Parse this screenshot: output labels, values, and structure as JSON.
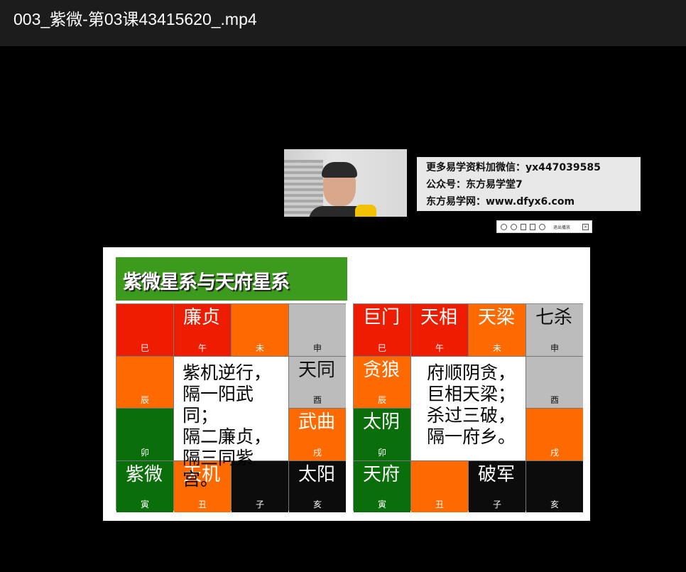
{
  "window": {
    "title": "003_紫微-第03课43415620_.mp4"
  },
  "promo": {
    "line1": "更多易学资料加微信：yx447039585",
    "line2": "公众号：东方易学堂7",
    "line3": "东方易学网：www.dfyx6.com"
  },
  "toolbar": {
    "label": "退出播放"
  },
  "slide": {
    "title": "紫微星系与天府星系",
    "left_chart": {
      "cells": [
        {
          "star": "",
          "branch": "巳",
          "color": "red"
        },
        {
          "star": "廉贞",
          "branch": "午",
          "color": "red"
        },
        {
          "star": "",
          "branch": "未",
          "color": "orange"
        },
        {
          "star": "",
          "branch": "申",
          "color": "gray"
        },
        {
          "star": "",
          "branch": "辰",
          "color": "orange"
        },
        {
          "star": "天同",
          "branch": "酉",
          "color": "gray"
        },
        {
          "star": "",
          "branch": "卯",
          "color": "green"
        },
        {
          "star": "武曲",
          "branch": "戌",
          "color": "orange"
        },
        {
          "star": "紫微",
          "branch": "寅",
          "color": "green"
        },
        {
          "star": "天机",
          "branch": "丑",
          "color": "orange"
        },
        {
          "star": "",
          "branch": "子",
          "color": "black"
        },
        {
          "star": "太阳",
          "branch": "亥",
          "color": "black"
        }
      ],
      "center_lines": [
        "紫机逆行，",
        "隔一阳武同；",
        "隔二廉贞，",
        "隔三同紫宫。"
      ]
    },
    "right_chart": {
      "cells": [
        {
          "star": "巨门",
          "branch": "巳",
          "color": "red"
        },
        {
          "star": "天相",
          "branch": "午",
          "color": "red"
        },
        {
          "star": "天梁",
          "branch": "未",
          "color": "orange"
        },
        {
          "star": "七杀",
          "branch": "申",
          "color": "gray"
        },
        {
          "star": "贪狼",
          "branch": "辰",
          "color": "orange"
        },
        {
          "star": "",
          "branch": "酉",
          "color": "gray"
        },
        {
          "star": "太阴",
          "branch": "卯",
          "color": "green"
        },
        {
          "star": "",
          "branch": "戌",
          "color": "orange"
        },
        {
          "star": "天府",
          "branch": "寅",
          "color": "green"
        },
        {
          "star": "",
          "branch": "丑",
          "color": "orange"
        },
        {
          "star": "破军",
          "branch": "子",
          "color": "black"
        },
        {
          "star": "",
          "branch": "亥",
          "color": "black"
        }
      ],
      "center_lines": [
        "府顺阴贪，",
        "巨相天梁；",
        "杀过三破，",
        "隔一府乡。"
      ]
    }
  },
  "colors": {
    "red": "#ee1c00",
    "orange": "#ff6a00",
    "gray": "#bcbcbc",
    "green": "#0a6e0a",
    "black": "#0c0c0c",
    "banner": "#3c9a1c"
  }
}
